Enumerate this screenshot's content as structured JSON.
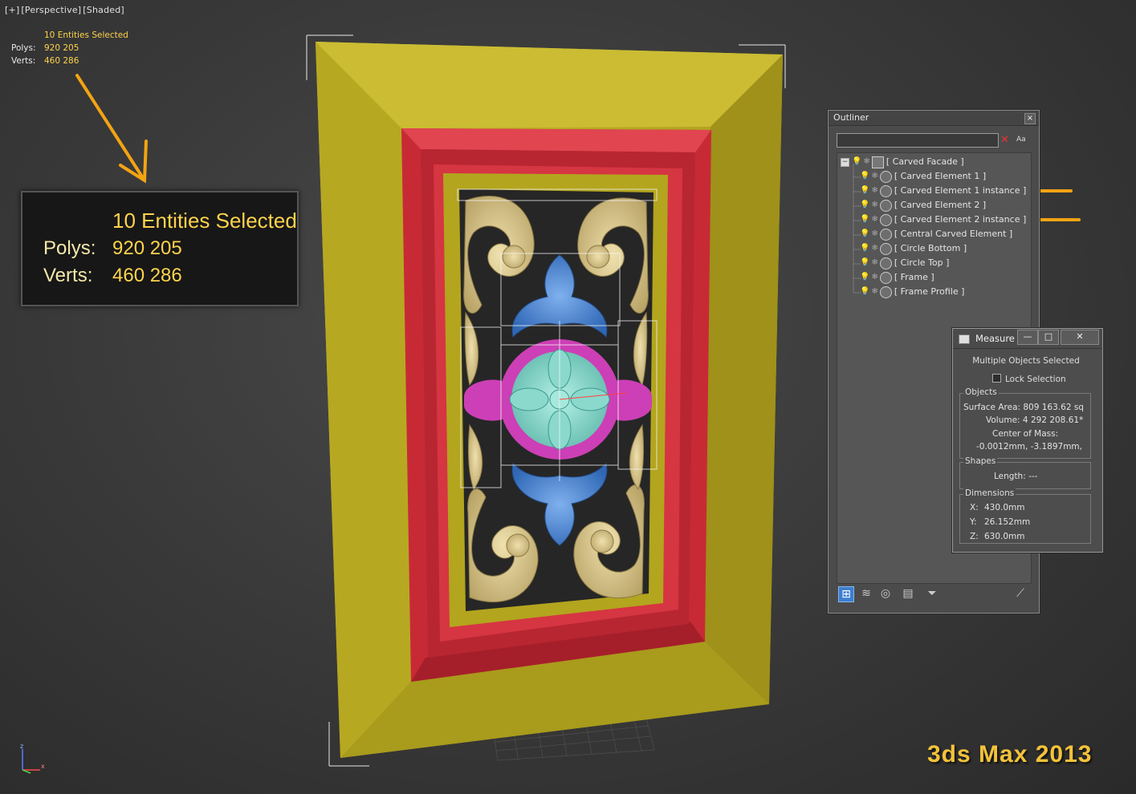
{
  "viewport": {
    "label_parts": [
      "[+]",
      "[Perspective]",
      "[Shaded]"
    ],
    "stats_small": {
      "selected": "10 Entities Selected",
      "polys_label": "Polys:",
      "polys_value": "920 205",
      "verts_label": "Verts:",
      "verts_value": "460 286"
    },
    "stats_big": {
      "selected": "10 Entities Selected",
      "polys_label": "Polys:",
      "polys_value": "920 205",
      "verts_label": "Verts:",
      "verts_value": "460 286"
    },
    "brand": "3ds Max 2013",
    "axis": {
      "z": "z",
      "x": "x",
      "y": "y"
    }
  },
  "outliner": {
    "title": "Outliner",
    "close_label": "×",
    "search_value": "",
    "clear_icon": "✕",
    "case_label": "Aa",
    "root": "[ Carved Facade ]",
    "items": [
      "[ Carved Element 1 ]",
      "[ Carved Element 1 instance ]",
      "[ Carved Element 2 ]",
      "[ Carved Element 2 instance ]",
      "[ Central Carved Element ]",
      "[ Circle Bottom ]",
      "[ Circle Top ]",
      "[ Frame ]",
      "[ Frame Profile ]"
    ],
    "toolbar_icons": [
      "hierarchy-icon",
      "layers-icon",
      "material-icon",
      "display-icon",
      "filter-icon",
      "pick-icon"
    ]
  },
  "measure": {
    "title": "Measure",
    "multi": "Multiple Objects Selected",
    "lock_label": "Lock Selection",
    "objects_group": "Objects",
    "surface_area": "Surface Area:  809 163.62 sq",
    "volume": "Volume:  4 292 208.61*",
    "center_label": "Center of Mass:",
    "center_value": "-0.0012mm, -3.1897mm,",
    "shapes_group": "Shapes",
    "length": "Length:  ---",
    "dimensions_group": "Dimensions",
    "dim_x_label": "X:",
    "dim_x": "430.0mm",
    "dim_y_label": "Y:",
    "dim_y": "26.152mm",
    "dim_z_label": "Z:",
    "dim_z": "630.0mm"
  },
  "colors": {
    "accent_yellow": "#ffd34d",
    "annotation_orange": "#f2a413",
    "frame_yellow": "#b3a51e",
    "frame_red": "#c72a35",
    "carving_gold": "#d8c48b",
    "carving_blue": "#4d86d0",
    "carving_pink": "#cc3fb6",
    "carving_teal": "#7fd0c5"
  }
}
